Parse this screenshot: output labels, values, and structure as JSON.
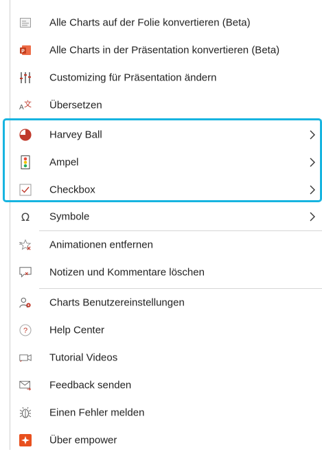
{
  "menu": {
    "items": [
      {
        "label": "Alle Charts auf der Folie konvertieren (Beta)",
        "icon": "slide-chart-icon"
      },
      {
        "label": "Alle Charts in der Präsentation konvertieren (Beta)",
        "icon": "powerpoint-icon"
      },
      {
        "label": "Customizing für Präsentation ändern",
        "icon": "sliders-icon"
      },
      {
        "label": "Übersetzen",
        "icon": "translate-icon"
      },
      {
        "label": "Harvey Ball",
        "icon": "harvey-ball-icon",
        "submenu": true
      },
      {
        "label": "Ampel",
        "icon": "traffic-light-icon",
        "submenu": true
      },
      {
        "label": "Checkbox",
        "icon": "checkbox-icon",
        "submenu": true
      },
      {
        "label": "Symbole",
        "icon": "omega-icon",
        "submenu": true
      },
      {
        "label": "Animationen entfernen",
        "icon": "remove-animation-icon"
      },
      {
        "label": "Notizen und Kommentare löschen",
        "icon": "delete-comments-icon"
      },
      {
        "label": "Charts Benutzereinstellungen",
        "icon": "user-settings-icon"
      },
      {
        "label": "Help Center",
        "icon": "help-icon"
      },
      {
        "label": "Tutorial Videos",
        "icon": "video-icon"
      },
      {
        "label": "Feedback senden",
        "icon": "mail-icon"
      },
      {
        "label": "Einen Fehler melden",
        "icon": "bug-icon"
      },
      {
        "label": "Über empower",
        "icon": "empower-logo-icon"
      }
    ]
  },
  "colors": {
    "highlight_border": "#17b4e0",
    "accent_red": "#c0392b",
    "empower_orange": "#e8501e"
  }
}
